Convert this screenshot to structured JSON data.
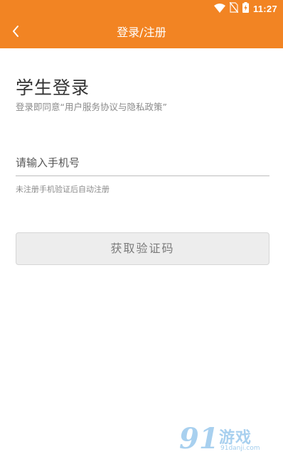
{
  "status_bar": {
    "time": "11:27",
    "icons": [
      "wifi-icon",
      "no-sim-icon",
      "battery-charging-icon"
    ]
  },
  "app_bar": {
    "title": "登录/注册",
    "back_icon": "chevron-left-icon"
  },
  "login": {
    "heading": "学生登录",
    "agreement_text": "登录即同意“用户服务协议与隐私政策”",
    "phone_placeholder": "请输入手机号",
    "phone_value": "",
    "hint": "未注册手机验证后自动注册",
    "get_code_label": "获取验证码"
  },
  "watermark": {
    "logo": "91",
    "text": "游戏",
    "url": "91danji.com"
  },
  "colors": {
    "accent": "#f28423",
    "button_bg": "#ededed",
    "button_text": "#7b7b7b"
  }
}
